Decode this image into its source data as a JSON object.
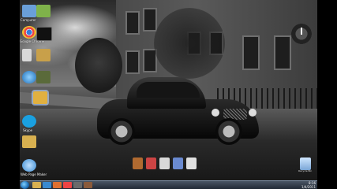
{
  "desktop_icons": [
    {
      "name": "computer-icon",
      "label": "Computer",
      "color": "#6a9fd8"
    },
    {
      "name": "folder-green-icon",
      "label": "",
      "color": "#7fb24a"
    },
    {
      "name": "chrome-icon",
      "label": "Google Chrome",
      "color": "#e44"
    },
    {
      "name": "app-black-icon",
      "label": "",
      "color": "#111"
    },
    {
      "name": "file-icon",
      "label": "",
      "color": "#eee"
    },
    {
      "name": "folder-icon",
      "label": "",
      "color": "#c8a04a"
    },
    {
      "name": "network-icon",
      "label": "",
      "color": "#4a9ad8"
    },
    {
      "name": "media-icon",
      "label": "",
      "color": "#5a6a3a"
    },
    {
      "name": "folder-selected-icon",
      "label": "",
      "color": "#e0b040"
    },
    {
      "name": "skype-icon",
      "label": "Skype",
      "color": "#1aa0e0"
    },
    {
      "name": "folder-yellow-icon",
      "label": "",
      "color": "#d8b050"
    },
    {
      "name": "web-page-icon",
      "label": "Web Page Maker",
      "color": "#3a8ad0"
    }
  ],
  "dock": {
    "items": [
      {
        "name": "dock-item-1",
        "color": "#b06a30"
      },
      {
        "name": "dock-item-2",
        "color": "#c44"
      },
      {
        "name": "dock-item-3",
        "color": "#d8d8d8"
      },
      {
        "name": "dock-item-4",
        "color": "#6a8ad0"
      },
      {
        "name": "dock-item-5",
        "color": "#e0e0e0"
      }
    ]
  },
  "recycle_bin": {
    "label": "Recycle Bin"
  },
  "taskbar": {
    "buttons": [
      {
        "name": "taskbar-explorer",
        "color": "#d8b050"
      },
      {
        "name": "taskbar-ie",
        "color": "#3a8ad0"
      },
      {
        "name": "taskbar-media",
        "color": "#e07030"
      },
      {
        "name": "taskbar-chrome",
        "color": "#e44"
      },
      {
        "name": "taskbar-app",
        "color": "#6a6a6a"
      },
      {
        "name": "taskbar-app2",
        "color": "#8a5a3a"
      }
    ],
    "clock_time": "8:16",
    "clock_date": "1/4/2011"
  }
}
